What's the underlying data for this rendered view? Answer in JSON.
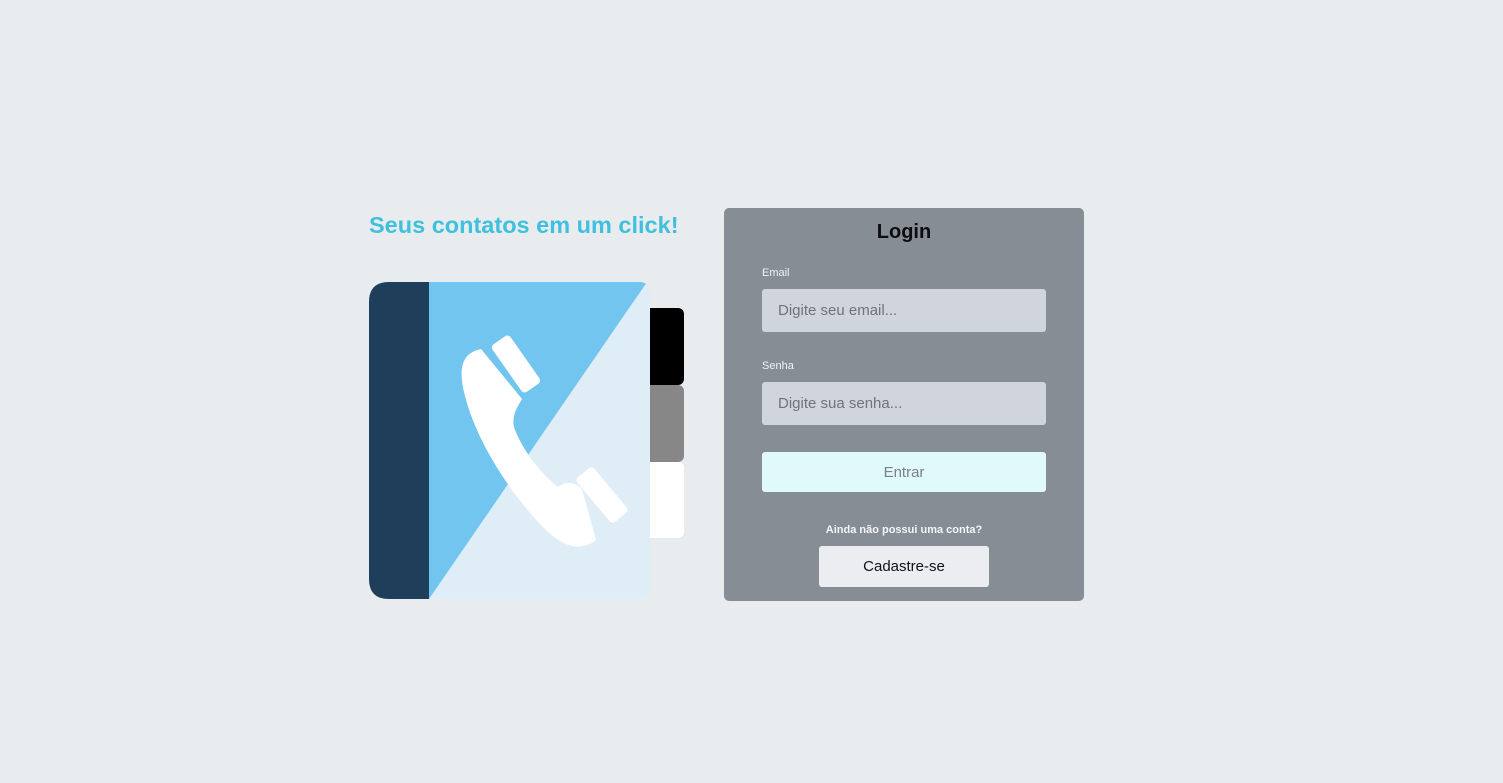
{
  "hero": {
    "tagline": "Seus contatos em um click!",
    "illustration_icon": "phone-book-icon",
    "colors": {
      "accent": "#3fc0dc",
      "spine": "#1e3e5a",
      "cover": "#72c5ee",
      "page": "#dfeef6",
      "tab_1": "#000000",
      "tab_2": "#878787",
      "tab_3": "#ffffff"
    }
  },
  "login": {
    "title": "Login",
    "email": {
      "label": "Email",
      "placeholder": "Digite seu email...",
      "value": ""
    },
    "password": {
      "label": "Senha",
      "placeholder": "Digite sua senha...",
      "value": ""
    },
    "submit_label": "Entrar",
    "signup_prompt": "Ainda não possui uma conta?",
    "signup_label": "Cadastre-se",
    "colors": {
      "card": "#868d95",
      "input": "#d0d4dc",
      "submit": "#e0f9fa",
      "signup": "#ebedf0"
    }
  }
}
